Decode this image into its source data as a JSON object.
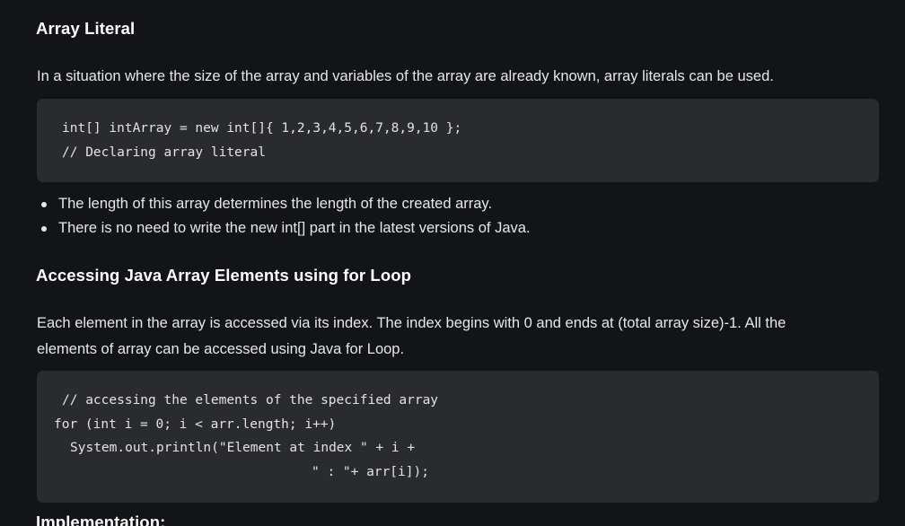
{
  "section1": {
    "heading": "Array Literal",
    "paragraph": "In a situation where the size of the array and variables of the array are already known, array literals can be used.",
    "code": [
      "int[] intArray = new int[]{ 1,2,3,4,5,6,7,8,9,10 };",
      "// Declaring array literal"
    ],
    "bullets": [
      "The length of this array determines the length of the created array.",
      "There is no need to write the new int[] part in the latest versions of Java."
    ]
  },
  "section2": {
    "heading": "Accessing Java Array Elements using for Loop",
    "paragraph_lines": [
      "Each element in the array is accessed via its index. The index begins with 0 and ends at (total array size)-1. All the",
      "elements of array can be accessed using Java for Loop."
    ],
    "code": [
      "// accessing the elements of the specified array",
      "for (int i = 0; i < arr.length; i++)",
      "System.out.println(\"Element at index \" + i +",
      "\" : \"+ arr[i]);"
    ]
  },
  "section3": {
    "heading": "Implementation:"
  }
}
